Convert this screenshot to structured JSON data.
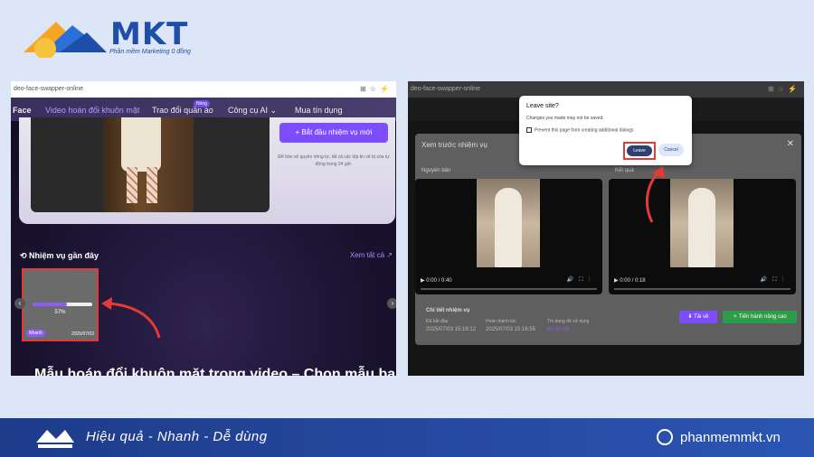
{
  "logo": {
    "name": "MKT",
    "tagline": "Phần mềm Marketing 0 đồng"
  },
  "left": {
    "url": "deo-face-swapper-online",
    "nav": [
      "Face",
      "Video hoán đổi khuôn mặt",
      "Trao đổi quần áo",
      "Công cụ AI",
      "Mua tín dụng"
    ],
    "nav_badge": "Nóng",
    "nav_dropdown": "⌄",
    "start_button": "+ Bắt đầu nhiệm vụ mới",
    "note": "Để bảo vệ quyền riêng tư, tất cả các tệp tin sẽ bị xóa tự động trong 24 giờ.",
    "recent_title": "Nhiệm vụ gần đây",
    "see_all": "Xem tất cả",
    "task": {
      "percent_label": "57%",
      "progress": 0.57,
      "chip": "Nhanh",
      "date": "2025/07/03"
    },
    "bottom_heading": "Mẫu hoán đổi khuôn mặt trong video – Chọn mẫu bạn thích"
  },
  "right": {
    "url": "deo-face-swapper-online",
    "modal_title": "Xem trước nhiệm vụ",
    "original_label": "Nguyên bản",
    "result_label": "Kết quả",
    "video1_time": "0:00 / 0:40",
    "video2_time": "0:00 / 0:18",
    "details_title": "Chi tiết nhiệm vụ",
    "col_start": "Đã bắt đầu",
    "col_done": "Hoàn thành lúc",
    "col_credits": "Tín dụng đã sử dụng",
    "val_start": "2025/07/03 15:16:12",
    "val_done": "2025/07/03 15:16:55",
    "val_credits": "60 tín chỉ",
    "download": "Tải về",
    "advanced": "Tiến hành nâng cao",
    "dialog": {
      "title": "Leave site?",
      "message": "Changes you made may not be saved.",
      "checkbox": "Prevent this page from creating additional dialogs",
      "leave": "Leave",
      "cancel": "Cancel"
    }
  },
  "footer": {
    "slogan": "Hiệu quả - Nhanh - Dễ dùng",
    "site": "phanmemmkt.vn"
  },
  "colors": {
    "accent_purple": "#7c4dff",
    "highlight_red": "#e53935",
    "brand_blue": "#1e4fa8"
  }
}
